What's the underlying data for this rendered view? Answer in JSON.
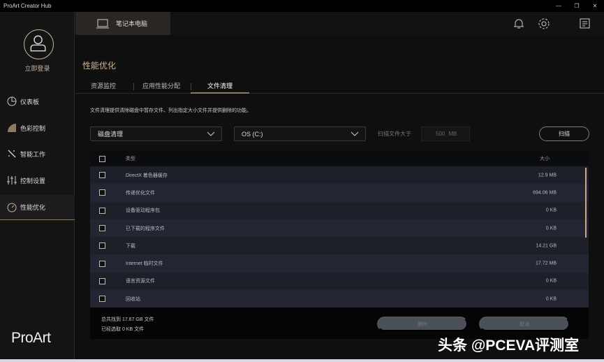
{
  "app_title": "ProArt Creator Hub",
  "window_controls": [
    "—",
    "❐",
    "✕"
  ],
  "sidebar": {
    "login": "立即登录",
    "items": [
      {
        "label": "仪表板",
        "icon": "dashboard-icon"
      },
      {
        "label": "色彩控制",
        "icon": "color-icon"
      },
      {
        "label": "智能工作",
        "icon": "magic-wand-icon"
      },
      {
        "label": "控制设置",
        "icon": "sliders-icon"
      },
      {
        "label": "性能优化",
        "icon": "gauge-icon",
        "active": true
      }
    ],
    "logo": "ProArt"
  },
  "header": {
    "device": "笔记本电脑"
  },
  "page": {
    "title": "性能优化",
    "tabs": [
      "资源监控",
      "应用性能分配",
      "文件清理"
    ],
    "active_tab": 2,
    "description": "文件清理提供清除磁盘中暂存文件、列出指定大小文件并提供删除的功能。",
    "mode_select": "磁盘清理",
    "drive_select": "OS (C:)",
    "size_label": "扫描文件大于",
    "size_value": "500",
    "size_unit": "MB",
    "scan_button": "扫描"
  },
  "table": {
    "headers": {
      "type": "类型",
      "size": "大小"
    },
    "rows": [
      {
        "name": "DirectX 着色器缓存",
        "size": "12.9 MB"
      },
      {
        "name": "传递优化文件",
        "size": "694.06 MB"
      },
      {
        "name": "设备驱动程序包",
        "size": "0 KB"
      },
      {
        "name": "已下载的程序文件",
        "size": "0 KB"
      },
      {
        "name": "下载",
        "size": "14.21 GB"
      },
      {
        "name": "Internet 临时文件",
        "size": "17.72 MB"
      },
      {
        "name": "语言资源文件",
        "size": "0 KB"
      },
      {
        "name": "回收站",
        "size": "0 KB"
      }
    ]
  },
  "footer": {
    "total": "总共找到 17.67 GB 文件",
    "selected": "已经选取 0 KB 文件",
    "delete": "删除",
    "cancel": "取消"
  },
  "watermark": "头条 @PCEVA评测室",
  "colors": {
    "accent": "#c9b59a",
    "underline": "#8d7a62"
  }
}
